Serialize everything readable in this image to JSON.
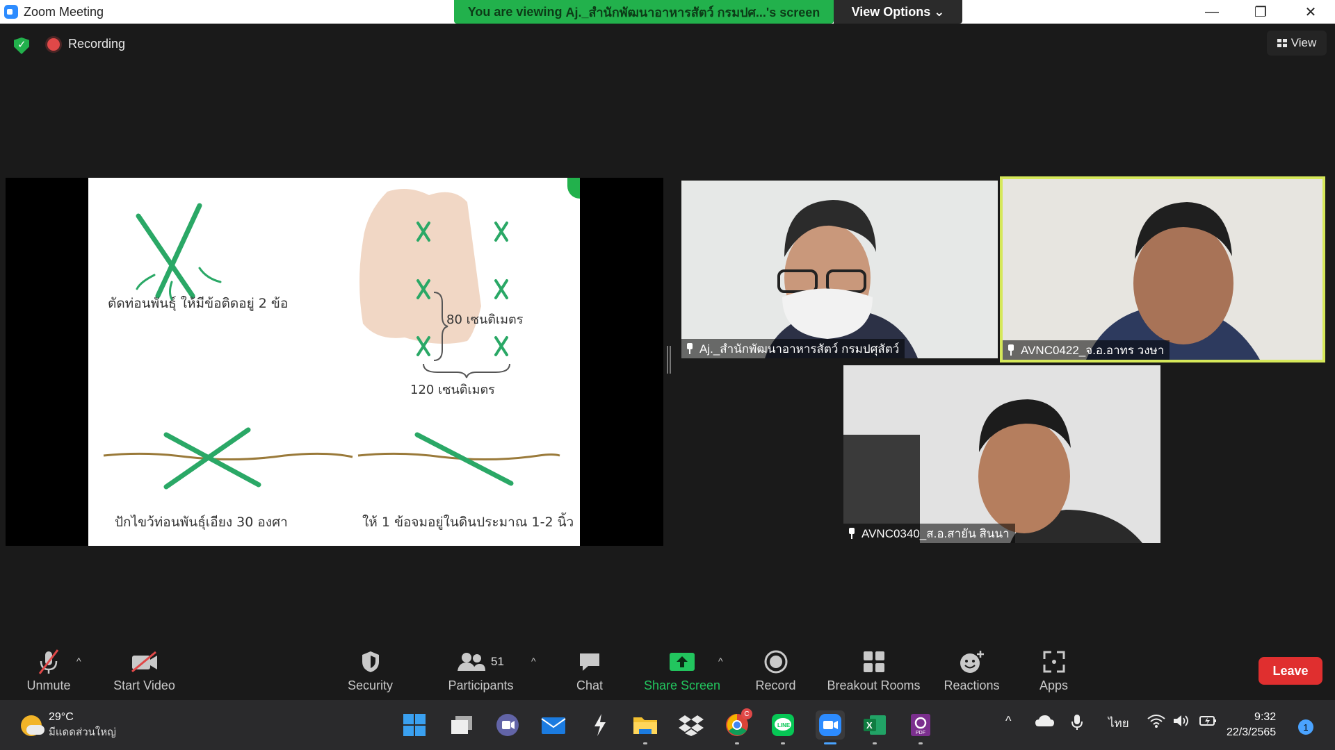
{
  "window": {
    "title": "Zoom Meeting",
    "minimize": "—",
    "restore": "❐",
    "close": "✕"
  },
  "share_banner": {
    "prefix": "You are viewing ",
    "presenter": "Aj._สำนักพัฒนาอาหารสัตว์ กรมปศ...'s screen",
    "view_options_label": "View Options ⌄"
  },
  "status": {
    "recording_label": "Recording",
    "view_label": "View"
  },
  "slide": {
    "caption_1": "ตัดท่อนพันธุ์ ให้มีข้อติดอยู่ 2 ข้อ",
    "label_80": "80 เซนติเมตร",
    "label_120": "120 เซนติเมตร",
    "caption_2": "ปักไขว้ท่อนพันธุ์เอียง 30 องศา",
    "caption_3": "ให้ 1 ข้อจมอยู่ในดินประมาณ 1-2 นิ้ว"
  },
  "participants_video": [
    {
      "name": "Aj._สำนักพัฒนาอาหารสัตว์ กรมปศุสัตว์"
    },
    {
      "name": "AVNC0422_จ.อ.อาทร  วงษา"
    },
    {
      "name": "AVNC0340_ส.อ.สายัน สินนา"
    }
  ],
  "toolbar": {
    "unmute": "Unmute",
    "start_video": "Start Video",
    "security": "Security",
    "participants": "Participants",
    "participants_count": "51",
    "chat": "Chat",
    "share_screen": "Share Screen",
    "record": "Record",
    "breakout_rooms": "Breakout Rooms",
    "reactions": "Reactions",
    "apps": "Apps",
    "leave": "Leave",
    "caret": "^"
  },
  "taskbar": {
    "temperature": "29°C",
    "weather_desc": "มีแดดส่วนใหญ่",
    "language": "ไทย",
    "time": "9:32",
    "date": "22/3/2565",
    "notification_count": "1",
    "chrome_badge": "C",
    "tray_caret": "^"
  },
  "colors": {
    "share_green": "#22b14c",
    "leave_red": "#e02f2f",
    "active_speaker": "#d6e85a",
    "zoom_blue": "#2d8cff"
  }
}
